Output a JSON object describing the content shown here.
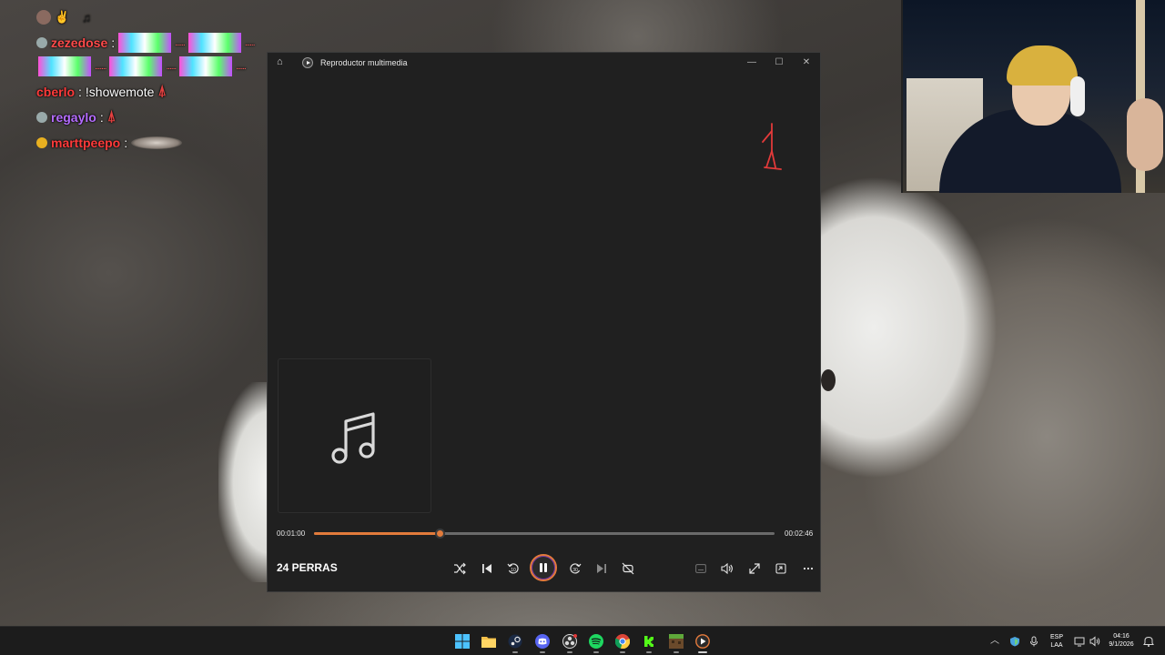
{
  "chat": {
    "lines": [
      {
        "user": "zezedose",
        "user_color": "#ff4a4a",
        "text": ""
      },
      {
        "user": "cberlo",
        "user_color": "#ff3a3a",
        "text": "!showemote"
      },
      {
        "user": "regaylo",
        "user_color": "#b56cff",
        "text": ""
      },
      {
        "user": "marttpeepo",
        "user_color": "#ff3a3a",
        "text": ""
      }
    ]
  },
  "player": {
    "window_title": "Reproductor multimedia",
    "track_title": "24 PERRAS",
    "time_elapsed": "00:01:00",
    "time_total": "00:02:46",
    "progress": 0.272,
    "accent_color": "#e27b3b",
    "controls": [
      "shuffle-icon",
      "previous-icon",
      "rewind-10-icon",
      "pause-icon",
      "forward-30-icon",
      "next-icon",
      "repeat-off-icon"
    ],
    "right_controls": [
      "subtitles-icon",
      "volume-icon",
      "fullscreen-icon",
      "mini-player-icon",
      "more-icon"
    ]
  },
  "taskbar": {
    "apps": [
      "start-icon",
      "file-explorer-icon",
      "steam-icon",
      "discord-icon",
      "obs-icon",
      "spotify-icon",
      "chrome-icon",
      "kick-icon",
      "minecraft-icon",
      "media-player-icon"
    ],
    "lang_primary": "ESP",
    "lang_secondary": "LAA",
    "time": "04:16",
    "date": "9/1/2026"
  }
}
